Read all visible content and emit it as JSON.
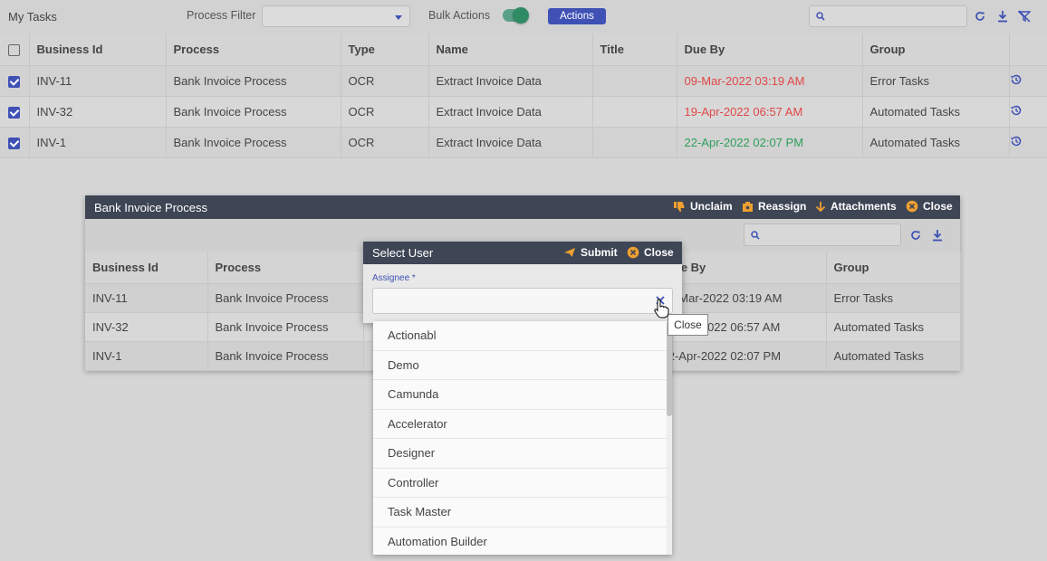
{
  "toolbar": {
    "title": "My Tasks",
    "process_filter_label": "Process Filter",
    "process_filter_value": "",
    "bulk_actions_label": "Bulk Actions",
    "bulk_actions_on": true,
    "actions_button": "Actions",
    "search_placeholder": ""
  },
  "grid": {
    "columns": [
      "Business Id",
      "Process",
      "Type",
      "Name",
      "Title",
      "Due By",
      "Group"
    ],
    "rows": [
      {
        "business_id": "INV-11",
        "process": "Bank Invoice Process",
        "type": "OCR",
        "name": "Extract Invoice Data",
        "title": "",
        "due_by": "09-Mar-2022 03:19 AM",
        "due_status": "overdue",
        "group": "Error Tasks",
        "checked": true
      },
      {
        "business_id": "INV-32",
        "process": "Bank Invoice Process",
        "type": "OCR",
        "name": "Extract Invoice Data",
        "title": "",
        "due_by": "19-Apr-2022 06:57 AM",
        "due_status": "overdue",
        "group": "Automated Tasks",
        "checked": true
      },
      {
        "business_id": "INV-1",
        "process": "Bank Invoice Process",
        "type": "OCR",
        "name": "Extract Invoice Data",
        "title": "",
        "due_by": "22-Apr-2022 02:07 PM",
        "due_status": "ok",
        "group": "Automated Tasks",
        "checked": true
      }
    ]
  },
  "panel": {
    "title": "Bank Invoice Process",
    "actions": {
      "unclaim": "Unclaim",
      "reassign": "Reassign",
      "attachments": "Attachments",
      "close": "Close"
    },
    "columns": {
      "business_id": "Business Id",
      "process": "Process",
      "due_by": "Due By",
      "group": "Group"
    },
    "rows": [
      {
        "business_id": "INV-11",
        "process": "Bank Invoice Process",
        "due_by": "09-Mar-2022 03:19 AM",
        "group": "Error Tasks"
      },
      {
        "business_id": "INV-32",
        "process": "Bank Invoice Process",
        "due_by": "19-Apr-2022 06:57 AM",
        "group": "Automated Tasks"
      },
      {
        "business_id": "INV-1",
        "process": "Bank Invoice Process",
        "due_by": "22-Apr-2022 02:07 PM",
        "group": "Automated Tasks"
      }
    ]
  },
  "dialog": {
    "title": "Select User",
    "submit": "Submit",
    "close": "Close",
    "assignee_label": "Assignee *",
    "assignee_value": ""
  },
  "dropdown": {
    "options": [
      "Actionabl",
      "Demo",
      "Camunda",
      "Accelerator",
      "Designer",
      "Controller",
      "Task Master",
      "Automation Builder"
    ]
  },
  "tooltip": "Close",
  "colors": {
    "accent": "#3f51b5",
    "header_dark": "#3e4555",
    "overdue": "#e04747",
    "on_time": "#2e9e5a",
    "toggle": "#2e8b63",
    "close_icon": "#f0a030"
  }
}
